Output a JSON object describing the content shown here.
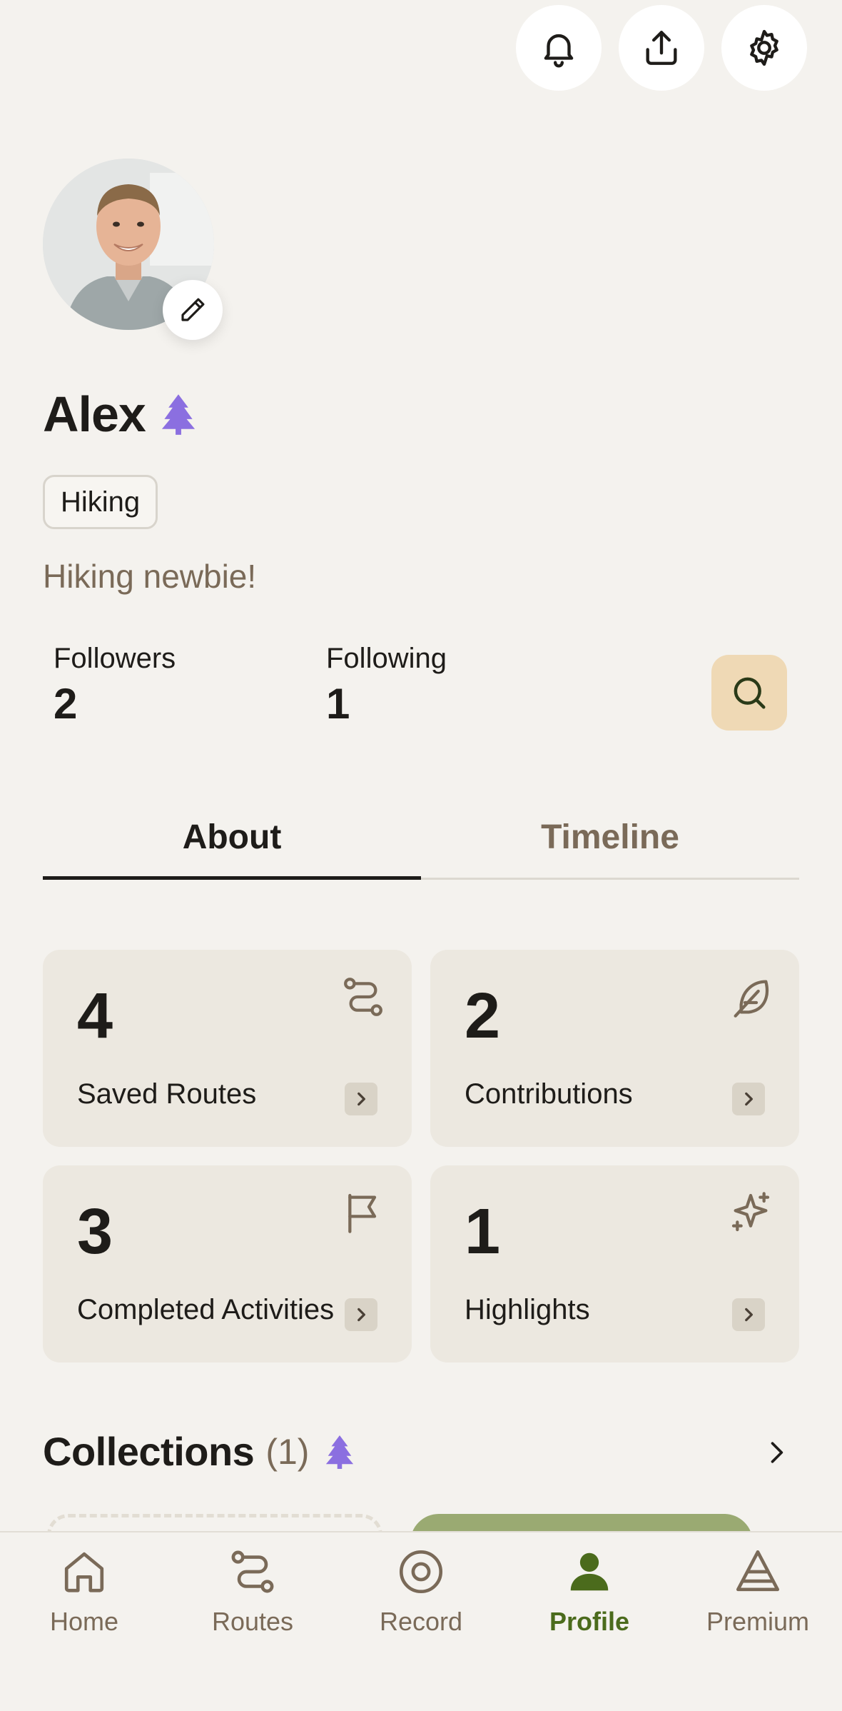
{
  "header": {
    "buttons": [
      {
        "icon": "bell-icon"
      },
      {
        "icon": "share-icon"
      },
      {
        "icon": "gear-icon"
      }
    ]
  },
  "profile": {
    "name": "Alex",
    "badge_icon": "tree-icon",
    "activity_chip": "Hiking",
    "bio": "Hiking newbie!",
    "followers_label": "Followers",
    "followers_count": "2",
    "following_label": "Following",
    "following_count": "1"
  },
  "tabs": [
    {
      "label": "About",
      "active": true
    },
    {
      "label": "Timeline",
      "active": false
    }
  ],
  "cards": [
    {
      "count": "4",
      "label": "Saved Routes",
      "icon": "route-icon"
    },
    {
      "count": "2",
      "label": "Contributions",
      "icon": "feather-icon"
    },
    {
      "count": "3",
      "label": "Completed Activities",
      "icon": "flag-icon"
    },
    {
      "count": "1",
      "label": "Highlights",
      "icon": "sparkle-icon"
    }
  ],
  "collections": {
    "title": "Collections",
    "count": "(1)"
  },
  "bottom_nav": [
    {
      "label": "Home",
      "icon": "home-icon",
      "active": false
    },
    {
      "label": "Routes",
      "icon": "routes-icon",
      "active": false
    },
    {
      "label": "Record",
      "icon": "record-icon",
      "active": false
    },
    {
      "label": "Profile",
      "icon": "profile-icon",
      "active": true
    },
    {
      "label": "Premium",
      "icon": "premium-icon",
      "active": false
    }
  ],
  "colors": {
    "background": "#f4f2ee",
    "card": "#ece8e0",
    "accent_green": "#4b6b1c",
    "premium_purple": "#8b6fe0",
    "search_button": "#efd9b5",
    "muted_brown": "#7a6a58"
  }
}
